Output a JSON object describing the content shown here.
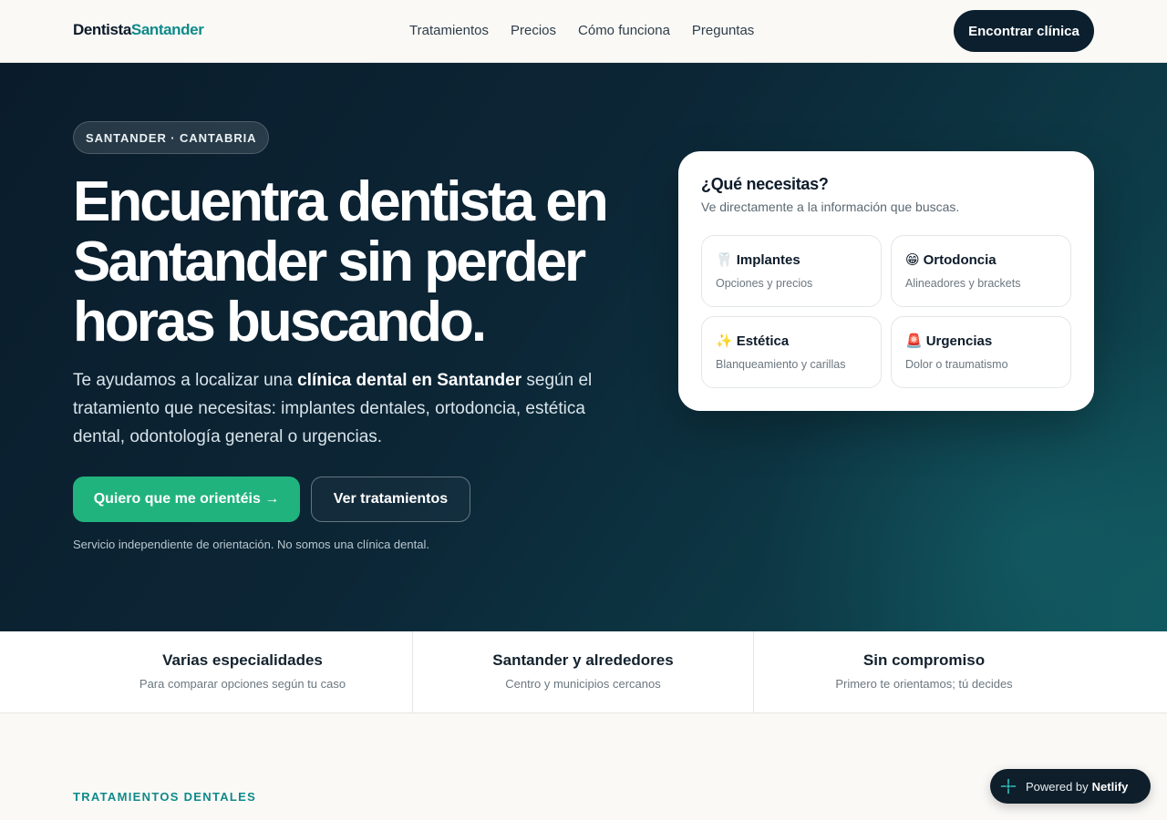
{
  "header": {
    "logo_part1": "Dentista",
    "logo_part2": "Santander",
    "nav": [
      "Tratamientos",
      "Precios",
      "Cómo funciona",
      "Preguntas"
    ],
    "cta": "Encontrar clínica"
  },
  "hero": {
    "badge": "SANTANDER · CANTABRIA",
    "title": "Encuentra dentista en Santander sin perder horas buscando.",
    "text_before": "Te ayudamos a localizar una ",
    "text_strong": "clínica dental en Santander",
    "text_after": " según el tratamiento que necesitas: implantes dentales, ortodoncia, estética dental, odontología general o urgencias.",
    "primary_button": "Quiero que me orientéis →",
    "secondary_button": "Ver tratamientos",
    "disclaimer": "Servicio independiente de orientación. No somos una clínica dental."
  },
  "card": {
    "title": "¿Qué necesitas?",
    "subtitle": "Ve directamente a la información que buscas.",
    "options": [
      {
        "emoji": "🦷",
        "title": "Implantes",
        "desc": "Opciones y precios"
      },
      {
        "emoji": "😁",
        "title": "Ortodoncia",
        "desc": "Alineadores y brackets"
      },
      {
        "emoji": "✨",
        "title": "Estética",
        "desc": "Blanqueamiento y carillas"
      },
      {
        "emoji": "🚨",
        "title": "Urgencias",
        "desc": "Dolor o traumatismo"
      }
    ]
  },
  "features": [
    {
      "title": "Varias especialidades",
      "desc": "Para comparar opciones según tu caso"
    },
    {
      "title": "Santander y alrededores",
      "desc": "Centro y municipios cercanos"
    },
    {
      "title": "Sin compromiso",
      "desc": "Primero te orientamos; tú decides"
    }
  ],
  "section": {
    "label": "TRATAMIENTOS DENTALES"
  },
  "netlify": {
    "prefix": "Powered by",
    "brand": "Netlify"
  },
  "colors": {
    "accent_teal": "#0f8a8a",
    "primary_green": "#21b37e",
    "dark_navy": "#0b1f2e"
  }
}
